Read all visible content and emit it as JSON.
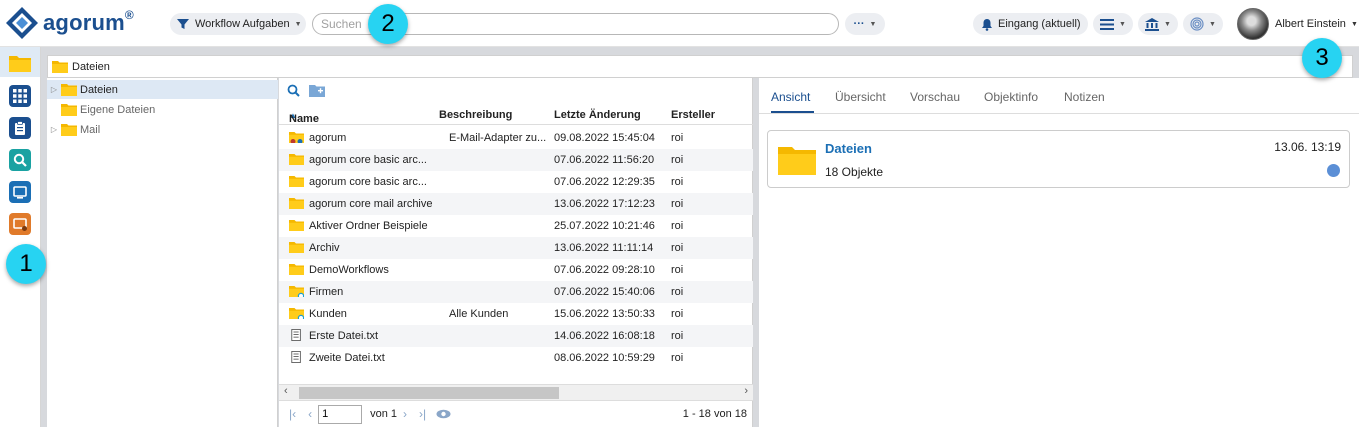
{
  "app": {
    "logo_text": "agorum",
    "logo_reg": "®"
  },
  "topbar": {
    "workflow_label": "Workflow Aufgaben",
    "search_placeholder": "Suchen",
    "more_label": "···",
    "inbox_label": "Eingang (aktuell)",
    "user_name": "Albert Einstein"
  },
  "callouts": [
    "1",
    "2",
    "3"
  ],
  "rail": {
    "items": [
      {
        "icon": "folder-icon",
        "color": "#f5b800"
      },
      {
        "icon": "apps-grid-icon",
        "color": "#1b4f8f"
      },
      {
        "icon": "clipboard-icon",
        "color": "#1b4f8f"
      },
      {
        "icon": "search-icon",
        "color": "#1aa2a2"
      },
      {
        "icon": "inbox-icon",
        "color": "#1b6fb5"
      },
      {
        "icon": "presentation-alert-icon",
        "color": "#e07a2a"
      }
    ]
  },
  "breadcrumb": {
    "label": "Dateien"
  },
  "tree": {
    "items": [
      {
        "label": "Dateien",
        "selected": true,
        "expandable": true
      },
      {
        "label": "Eigene Dateien",
        "selected": false,
        "expandable": false
      },
      {
        "label": "Mail",
        "selected": false,
        "expandable": true
      }
    ]
  },
  "list": {
    "columns": [
      "Name",
      "Beschreibung",
      "Letzte Änderung",
      "Ersteller"
    ],
    "sort_indicator": "▲",
    "rows": [
      {
        "name": "agorum",
        "description": "E-Mail-Adapter zu...",
        "modified": "09.08.2022 15:45:04",
        "creator": "roi",
        "type": "folder-special"
      },
      {
        "name": "agorum core basic arc...",
        "description": "",
        "modified": "07.06.2022 11:56:20",
        "creator": "roi",
        "type": "folder"
      },
      {
        "name": "agorum core basic arc...",
        "description": "",
        "modified": "07.06.2022 12:29:35",
        "creator": "roi",
        "type": "folder"
      },
      {
        "name": "agorum core mail archive",
        "description": "",
        "modified": "13.06.2022 17:12:23",
        "creator": "roi",
        "type": "folder"
      },
      {
        "name": "Aktiver Ordner Beispiele",
        "description": "",
        "modified": "25.07.2022 10:21:46",
        "creator": "roi",
        "type": "folder"
      },
      {
        "name": "Archiv",
        "description": "",
        "modified": "13.06.2022 11:11:14",
        "creator": "roi",
        "type": "folder"
      },
      {
        "name": "DemoWorkflows",
        "description": "",
        "modified": "07.06.2022 09:28:10",
        "creator": "roi",
        "type": "folder"
      },
      {
        "name": "Firmen",
        "description": "",
        "modified": "07.06.2022 15:40:06",
        "creator": "roi",
        "type": "folder-linked"
      },
      {
        "name": "Kunden",
        "description": "Alle Kunden",
        "modified": "15.06.2022 13:50:33",
        "creator": "roi",
        "type": "folder-linked"
      },
      {
        "name": "Erste Datei.txt",
        "description": "",
        "modified": "14.06.2022 16:08:18",
        "creator": "roi",
        "type": "file"
      },
      {
        "name": "Zweite Datei.txt",
        "description": "",
        "modified": "08.06.2022 10:59:29",
        "creator": "roi",
        "type": "file"
      }
    ],
    "pager": {
      "page_value": "1",
      "of_label": "von 1",
      "range_label": "1 - 18 von 18"
    }
  },
  "detail": {
    "tabs": [
      "Ansicht",
      "Übersicht",
      "Vorschau",
      "Objektinfo",
      "Notizen"
    ],
    "active_tab": "Ansicht",
    "card": {
      "title": "Dateien",
      "subtitle": "18 Objekte",
      "date": "13.06. 13:19"
    }
  }
}
